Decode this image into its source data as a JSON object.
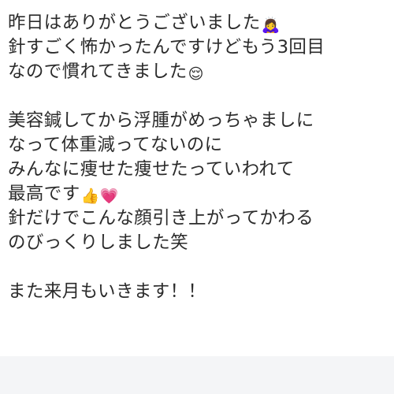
{
  "message": {
    "lines": [
      {
        "text": "昨日はありがとうございました",
        "emoji": "🙇‍♀️"
      },
      {
        "text": "針すごく怖かったんですけどもう3回目",
        "emoji": ""
      },
      {
        "text": "なので慣れてきました",
        "emoji": "😌"
      },
      {
        "text": "",
        "emoji": ""
      },
      {
        "text": "美容鍼してから浮腫がめっちゃましに",
        "emoji": ""
      },
      {
        "text": "なって体重減ってないのに",
        "emoji": ""
      },
      {
        "text": "みんなに痩せた痩せたっていわれて",
        "emoji": ""
      },
      {
        "text": "最高です",
        "emoji": "👍💗"
      },
      {
        "text": "針だけでこんな顔引き上がってかわる",
        "emoji": ""
      },
      {
        "text": "のびっくりしました笑",
        "emoji": ""
      },
      {
        "text": "",
        "emoji": ""
      },
      {
        "text": "また来月もいきます！！",
        "emoji": ""
      }
    ]
  }
}
